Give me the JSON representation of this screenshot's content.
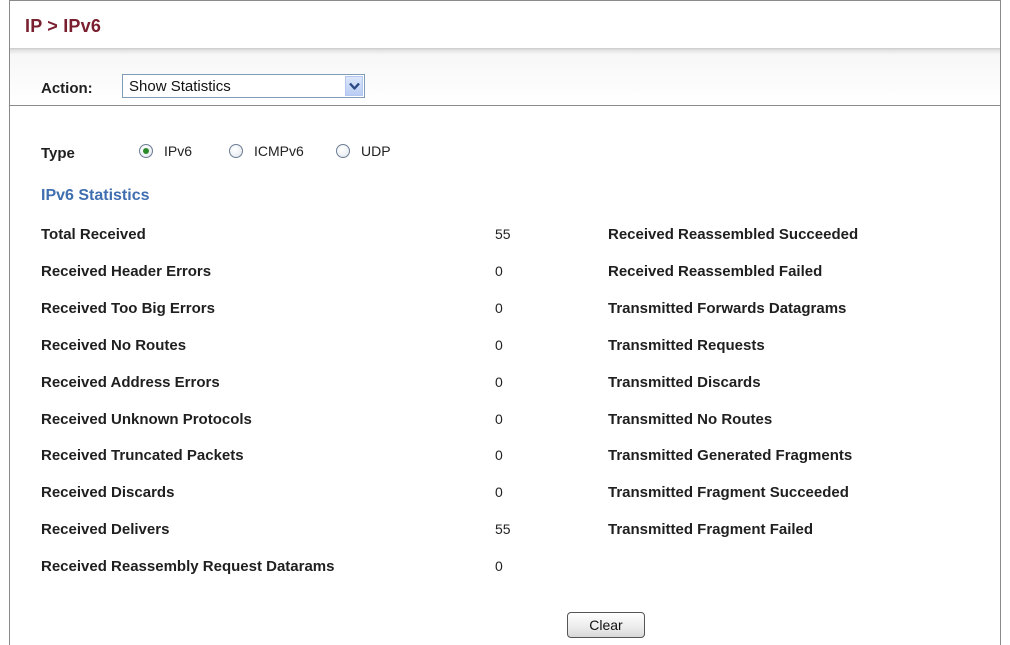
{
  "breadcrumb": "IP > IPv6",
  "action": {
    "label": "Action:",
    "selected": "Show Statistics"
  },
  "type": {
    "label": "Type",
    "options": [
      {
        "label": "IPv6",
        "selected": true
      },
      {
        "label": "ICMPv6",
        "selected": false
      },
      {
        "label": "UDP",
        "selected": false
      }
    ]
  },
  "section_title": "IPv6 Statistics",
  "stats": [
    {
      "left_label": "Total Received",
      "left_value": "55",
      "right_label": "Received Reassembled Succeeded"
    },
    {
      "left_label": "Received Header Errors",
      "left_value": "0",
      "right_label": "Received Reassembled Failed"
    },
    {
      "left_label": "Received Too Big Errors",
      "left_value": "0",
      "right_label": "Transmitted Forwards Datagrams"
    },
    {
      "left_label": "Received No Routes",
      "left_value": "0",
      "right_label": "Transmitted Requests"
    },
    {
      "left_label": "Received Address Errors",
      "left_value": "0",
      "right_label": "Transmitted Discards"
    },
    {
      "left_label": "Received Unknown Protocols",
      "left_value": "0",
      "right_label": "Transmitted No Routes"
    },
    {
      "left_label": "Received Truncated Packets",
      "left_value": "0",
      "right_label": "Transmitted Generated Fragments"
    },
    {
      "left_label": "Received Discards",
      "left_value": "0",
      "right_label": "Transmitted Fragment Succeeded"
    },
    {
      "left_label": "Received Delivers",
      "left_value": "55",
      "right_label": "Transmitted Fragment Failed"
    },
    {
      "left_label": "Received Reassembly Request Datarams",
      "left_value": "0",
      "right_label": ""
    }
  ],
  "clear_label": "Clear",
  "colors": {
    "breadcrumb": "#7a1f2f",
    "section_title": "#3f6fb0",
    "radio_selected": "#2a8a2a"
  },
  "icons": {
    "select_arrow": "chevron-down-icon",
    "radio": "radio-icon"
  }
}
